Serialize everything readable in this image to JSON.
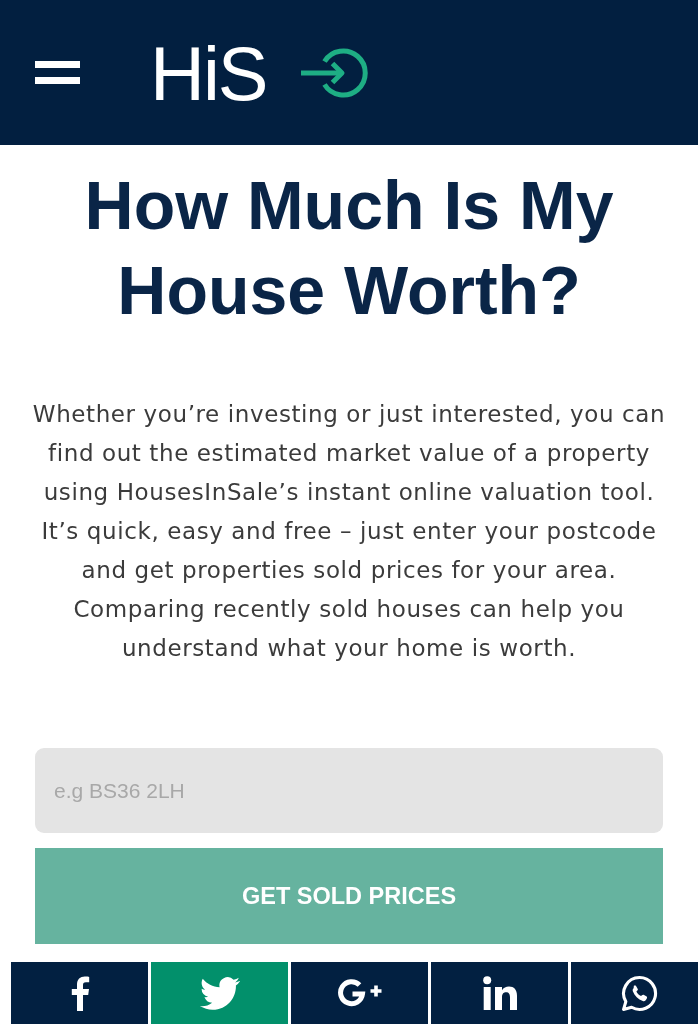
{
  "header": {
    "logo": "HiS"
  },
  "title": "How Much Is My House Worth?",
  "intro": "Whether you’re investing or just interested, you can find out the estimated market value of a property using HousesInSale’s instant online valuation tool. It’s quick, easy and free – just enter your postcode and get properties sold prices for your area. Comparing recently sold houses can help you understand what your home is worth.",
  "postcode_field": {
    "placeholder": "e.g BS36 2LH"
  },
  "submit_button": "GET SOLD PRICES",
  "share_bar": [
    {
      "kind": "facebook",
      "selected": false
    },
    {
      "kind": "twitter",
      "selected": true
    },
    {
      "kind": "googleplus",
      "selected": false
    },
    {
      "kind": "linkedin",
      "selected": false
    },
    {
      "kind": "whatsapp",
      "selected": false
    }
  ]
}
